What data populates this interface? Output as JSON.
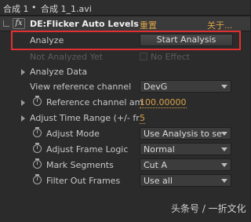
{
  "tabbar": {
    "item1": "合成 1",
    "separator": "•",
    "item2": "合成 1_1.avi"
  },
  "effect": {
    "fx_label": "fx",
    "name": "DE:Flicker Auto Levels",
    "reset": "重置",
    "about": "关于..."
  },
  "rows": {
    "analyze": {
      "label": "Analyze",
      "button": "Start Analysis"
    },
    "not_analyzed": {
      "label": "Not Analyzed Yet",
      "checkbox_label": "No Effect"
    },
    "analyze_data": {
      "label": "Analyze Data"
    },
    "view_ref_channel": {
      "label": "View reference channel",
      "value": "DevG"
    },
    "ref_channel_amount": {
      "label": "Reference channel am",
      "value": "100.00000"
    },
    "adjust_time_range": {
      "label": "Adjust Time Range (+/- fr",
      "value": "5"
    },
    "adjust_mode": {
      "label": "Adjust Mode",
      "value": "Use Analysis to se"
    },
    "adjust_frame_logic": {
      "label": "Adjust Frame Logic",
      "value": "Normal"
    },
    "mark_segments": {
      "label": "Mark Segments",
      "value": "Cut A"
    },
    "filter_out_frames": {
      "label": "Filter Out Frames",
      "value": "Use all"
    }
  },
  "watermark": "头条号 / 一折文化"
}
